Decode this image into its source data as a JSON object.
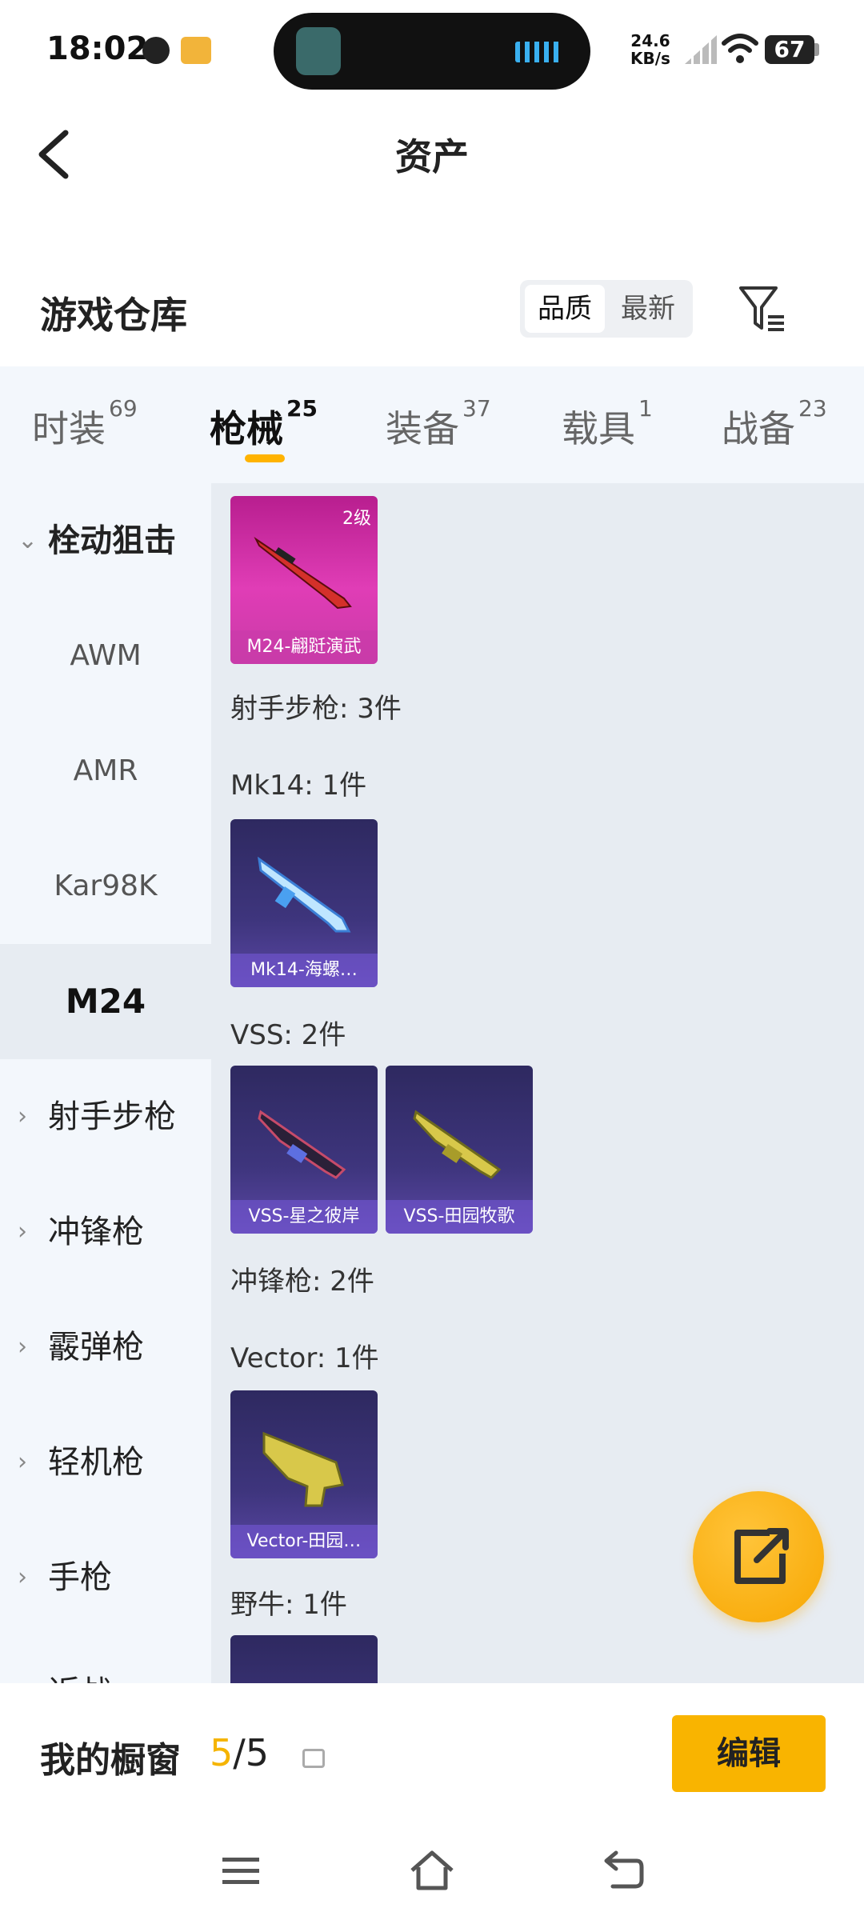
{
  "status_bar": {
    "time": "18:02",
    "net_speed_value": "24.6",
    "net_speed_unit": "KB/s",
    "battery": "67"
  },
  "header": {
    "title": "资产"
  },
  "warehouse": {
    "title": "游戏仓库",
    "sort_options": [
      "品质",
      "最新"
    ]
  },
  "tabs": [
    {
      "label": "时装",
      "count": "69"
    },
    {
      "label": "枪械",
      "count": "25"
    },
    {
      "label": "装备",
      "count": "37"
    },
    {
      "label": "载具",
      "count": "1"
    },
    {
      "label": "战备",
      "count": "23"
    }
  ],
  "sidebar": {
    "items": [
      {
        "label": "栓动狙击"
      },
      {
        "label": "AWM"
      },
      {
        "label": "AMR"
      },
      {
        "label": "Kar98K"
      },
      {
        "label": "M24"
      },
      {
        "label": "射手步枪"
      },
      {
        "label": "冲锋枪"
      },
      {
        "label": "霰弹枪"
      },
      {
        "label": "轻机枪"
      },
      {
        "label": "手枪"
      },
      {
        "label": "近战"
      }
    ]
  },
  "content": {
    "m24_card": {
      "level": "2级",
      "caption": "M24-翩跹演武"
    },
    "marksman_label": "射手步枪: 3件",
    "mk14_label": "Mk14: 1件",
    "mk14_card": {
      "caption": "Mk14-海螺…"
    },
    "vss_label": "VSS: 2件",
    "vss_cards": [
      {
        "caption": "VSS-星之彼岸"
      },
      {
        "caption": "VSS-田园牧歌"
      }
    ],
    "smg_label": "冲锋枪: 2件",
    "vector_label": "Vector: 1件",
    "vector_card": {
      "caption": "Vector-田园…"
    },
    "bison_label": "野牛: 1件"
  },
  "showcase": {
    "label": "我的橱窗",
    "current": "5",
    "total": "/5",
    "edit_label": "编辑"
  },
  "colors": {
    "accent": "#f9b400",
    "tab_bg": "#f3f7fc",
    "content_bg": "#e7ecf2"
  }
}
